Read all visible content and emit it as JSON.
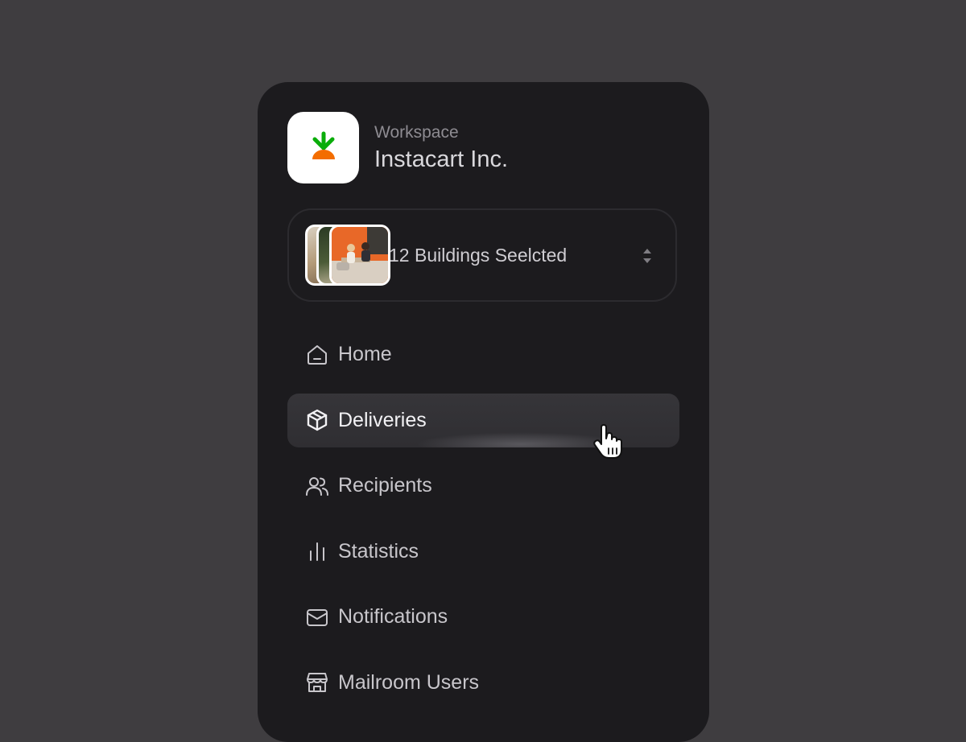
{
  "workspace": {
    "label": "Workspace",
    "name": "Instacart Inc."
  },
  "building_selector": {
    "label": "12 Buildings Seelcted"
  },
  "nav": {
    "items": [
      {
        "label": "Home",
        "icon": "home-icon"
      },
      {
        "label": "Deliveries",
        "icon": "package-icon",
        "active": true
      },
      {
        "label": "Recipients",
        "icon": "users-icon"
      },
      {
        "label": "Statistics",
        "icon": "bar-chart-icon"
      },
      {
        "label": "Notifications",
        "icon": "mail-icon"
      },
      {
        "label": "Mailroom Users",
        "icon": "store-icon"
      }
    ]
  },
  "colors": {
    "background": "#3f3d40",
    "panel": "#1c1b1e",
    "active_item": "#353438",
    "logo_green": "#0aad0a",
    "logo_orange": "#f36d00"
  }
}
